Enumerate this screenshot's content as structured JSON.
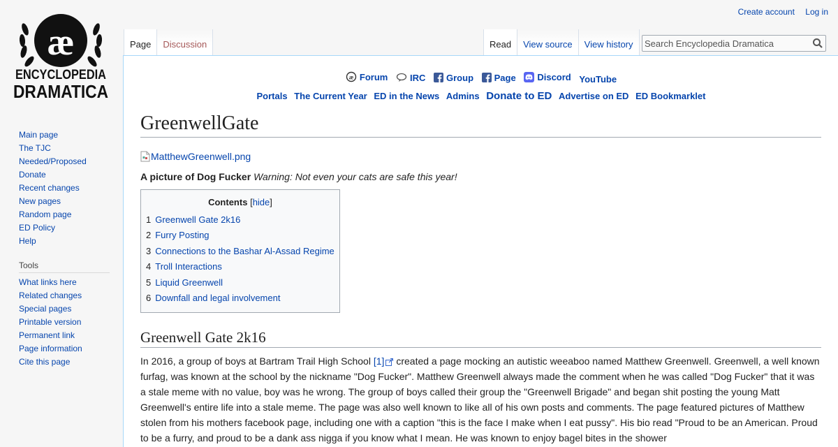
{
  "site": {
    "logo_monogram": "æ",
    "logo_line1": "ENCYCLOPEDIA",
    "logo_line2": "DRAMATICA"
  },
  "personal": {
    "create_account": "Create account",
    "login": "Log in"
  },
  "tabs": {
    "page": "Page",
    "discussion": "Discussion",
    "read": "Read",
    "view_source": "View source",
    "view_history": "View history"
  },
  "search": {
    "placeholder": "Search Encyclopedia Dramatica"
  },
  "nav": {
    "items": [
      "Main page",
      "The TJC",
      "Needed/Proposed",
      "Donate",
      "Recent changes",
      "New pages",
      "Random page",
      "ED Policy",
      "Help"
    ],
    "tools_heading": "Tools",
    "tools": [
      "What links here",
      "Related changes",
      "Special pages",
      "Printable version",
      "Permanent link",
      "Page information",
      "Cite this page"
    ]
  },
  "topbar": {
    "row1": [
      {
        "label": "Forum",
        "icon": "forum-icon"
      },
      {
        "label": "IRC",
        "icon": "irc-icon"
      },
      {
        "label": "Group",
        "icon": "facebook-icon"
      },
      {
        "label": "Page",
        "icon": "facebook-icon"
      },
      {
        "label": "Discord",
        "icon": "discord-icon"
      },
      {
        "label": "YouTube",
        "icon": ""
      }
    ],
    "row2": [
      "Portals",
      "The Current Year",
      "ED in the News",
      "Admins",
      "Donate to ED",
      "Advertise on ED",
      "ED Bookmarklet"
    ]
  },
  "article": {
    "title": "GreenwellGate",
    "image_alt": "MatthewGreenwell.png",
    "caption_bold": "A picture of Dog Fucker",
    "caption_italic": "Warning: Not even your cats are safe this year!",
    "toc": {
      "title": "Contents",
      "hide": "hide",
      "items": [
        {
          "num": "1",
          "label": "Greenwell Gate 2k16"
        },
        {
          "num": "2",
          "label": "Furry Posting"
        },
        {
          "num": "3",
          "label": "Connections to the Bashar Al-Assad Regime"
        },
        {
          "num": "4",
          "label": "Troll Interactions"
        },
        {
          "num": "5",
          "label": "Liquid Greenwell"
        },
        {
          "num": "6",
          "label": "Downfall and legal involvement"
        }
      ]
    },
    "section1_heading": "Greenwell Gate 2k16",
    "section1_p_before": "In 2016, a group of boys at Bartram Trail High School",
    "section1_ref": "[1]",
    "section1_p_after": "created a page mocking an autistic weeaboo named Matthew Greenwell. Greenwell, a well known furfag, was known at the school by the nickname \"Dog Fucker\". Matthew Greenwell always made the comment when he was called \"Dog Fucker\" that it was a stale meme with no value, boy was he wrong. The group of boys called their group the \"Greenwell Brigade\" and began shit posting the young Matt Greenwell's entire life into a stale meme. The page was also well known to like all of his own posts and comments. The page featured pictures of Matthew stolen from his mothers facebook page, including one with a caption \"this is the face I make when I eat pussy\". His bio read \"Proud to be an American. Proud to be a furry, and proud to be a dank ass nigga if you know what I mean. He was known to enjoy bagel bites in the shower"
  }
}
